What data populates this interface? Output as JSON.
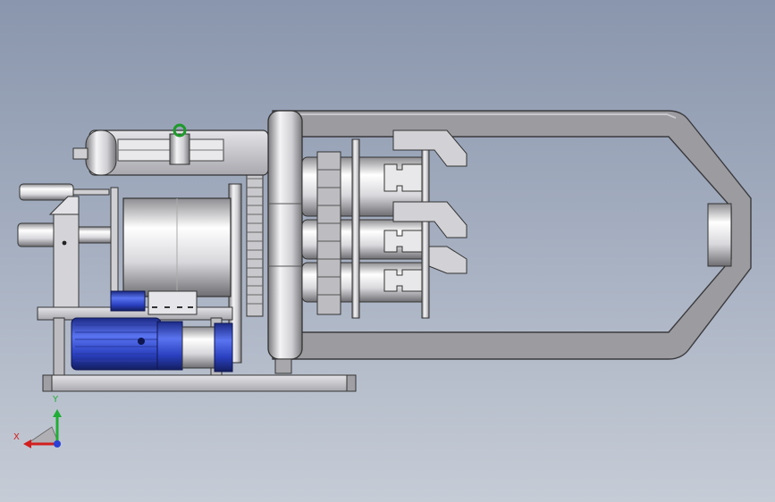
{
  "view": {
    "background_top": "#8a96ad",
    "background_bottom": "#c6ccd6"
  },
  "triad": {
    "x_label": "X",
    "y_label": "Y",
    "x_color": "#d21e1e",
    "y_color": "#1fae35",
    "z_color": "#2a3fd6"
  },
  "model": {
    "motor_color": "#3048c8",
    "frame_color": "#b4b4b8",
    "arm_color": "#9a9a9e",
    "indicator_color": "#1e9a2a"
  }
}
